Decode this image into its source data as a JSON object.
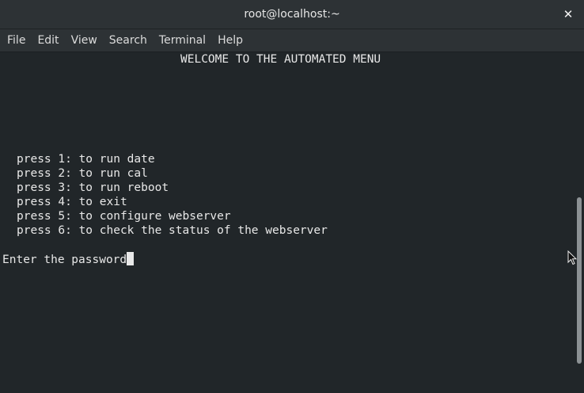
{
  "window": {
    "title": "root@localhost:~",
    "close_glyph": "✕"
  },
  "menubar": {
    "items": [
      "File",
      "Edit",
      "View",
      "Search",
      "Terminal",
      "Help"
    ]
  },
  "terminal": {
    "heading": "WELCOME TO THE AUTOMATED MENU",
    "options": [
      "press 1: to run date",
      "press 2: to run cal",
      "press 3: to run reboot",
      "press 4: to exit",
      "press 5: to configure webserver",
      "press 6: to check the status of the webserver"
    ],
    "prompt": "Enter the password"
  },
  "colors": {
    "terminal_bg": "#212629",
    "text": "#e8e8e8",
    "titlebar_bg": "#2d3235"
  }
}
